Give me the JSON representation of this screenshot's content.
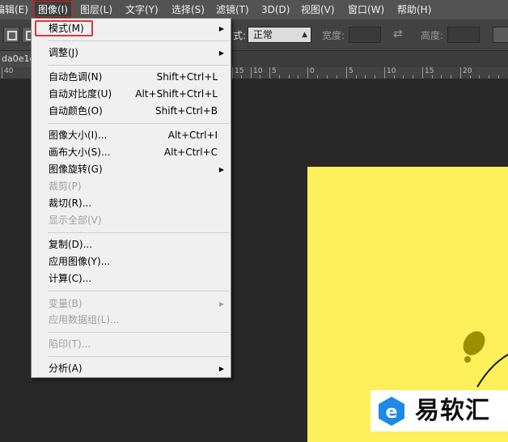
{
  "menubar": {
    "items": [
      "编辑(E)",
      "图像(I)",
      "图层(L)",
      "文字(Y)",
      "选择(S)",
      "滤镜(T)",
      "3D(D)",
      "视图(V)",
      "窗口(W)",
      "帮助(H)"
    ],
    "active_index": 1
  },
  "options": {
    "style_label": "式:",
    "style_value": "正常",
    "width_label": "宽度:",
    "height_label": "高度:"
  },
  "document": {
    "tab_label": "da0e1c"
  },
  "ruler": {
    "labels": [
      "40",
      "15",
      "10",
      "5",
      "0",
      "5",
      "10",
      "15",
      "20"
    ]
  },
  "image_menu": {
    "items": [
      {
        "label": "模式(M)",
        "shortcut": "",
        "submenu": true,
        "disabled": false
      },
      {
        "separator": true
      },
      {
        "label": "调整(J)",
        "shortcut": "",
        "submenu": true,
        "disabled": false
      },
      {
        "separator": true
      },
      {
        "label": "自动色调(N)",
        "shortcut": "Shift+Ctrl+L",
        "submenu": false,
        "disabled": false
      },
      {
        "label": "自动对比度(U)",
        "shortcut": "Alt+Shift+Ctrl+L",
        "submenu": false,
        "disabled": false
      },
      {
        "label": "自动颜色(O)",
        "shortcut": "Shift+Ctrl+B",
        "submenu": false,
        "disabled": false
      },
      {
        "separator": true
      },
      {
        "label": "图像大小(I)...",
        "shortcut": "Alt+Ctrl+I",
        "submenu": false,
        "disabled": false
      },
      {
        "label": "画布大小(S)...",
        "shortcut": "Alt+Ctrl+C",
        "submenu": false,
        "disabled": false
      },
      {
        "label": "图像旋转(G)",
        "shortcut": "",
        "submenu": true,
        "disabled": false
      },
      {
        "label": "裁剪(P)",
        "shortcut": "",
        "submenu": false,
        "disabled": true
      },
      {
        "label": "裁切(R)...",
        "shortcut": "",
        "submenu": false,
        "disabled": false
      },
      {
        "label": "显示全部(V)",
        "shortcut": "",
        "submenu": false,
        "disabled": true
      },
      {
        "separator": true
      },
      {
        "label": "复制(D)...",
        "shortcut": "",
        "submenu": false,
        "disabled": false
      },
      {
        "label": "应用图像(Y)...",
        "shortcut": "",
        "submenu": false,
        "disabled": false
      },
      {
        "label": "计算(C)...",
        "shortcut": "",
        "submenu": false,
        "disabled": false
      },
      {
        "separator": true
      },
      {
        "label": "变量(B)",
        "shortcut": "",
        "submenu": true,
        "disabled": true
      },
      {
        "label": "应用数据组(L)...",
        "shortcut": "",
        "submenu": false,
        "disabled": true
      },
      {
        "separator": true
      },
      {
        "label": "陷印(T)...",
        "shortcut": "",
        "submenu": false,
        "disabled": true
      },
      {
        "separator": true
      },
      {
        "label": "分析(A)",
        "shortcut": "",
        "submenu": true,
        "disabled": false
      }
    ]
  },
  "watermark": {
    "text": "易软汇"
  },
  "colors": {
    "menubar_bg": "#535353",
    "canvas_fill": "#fdf05a",
    "highlight_red": "#e03535",
    "olive_blob": "#9a9000"
  }
}
